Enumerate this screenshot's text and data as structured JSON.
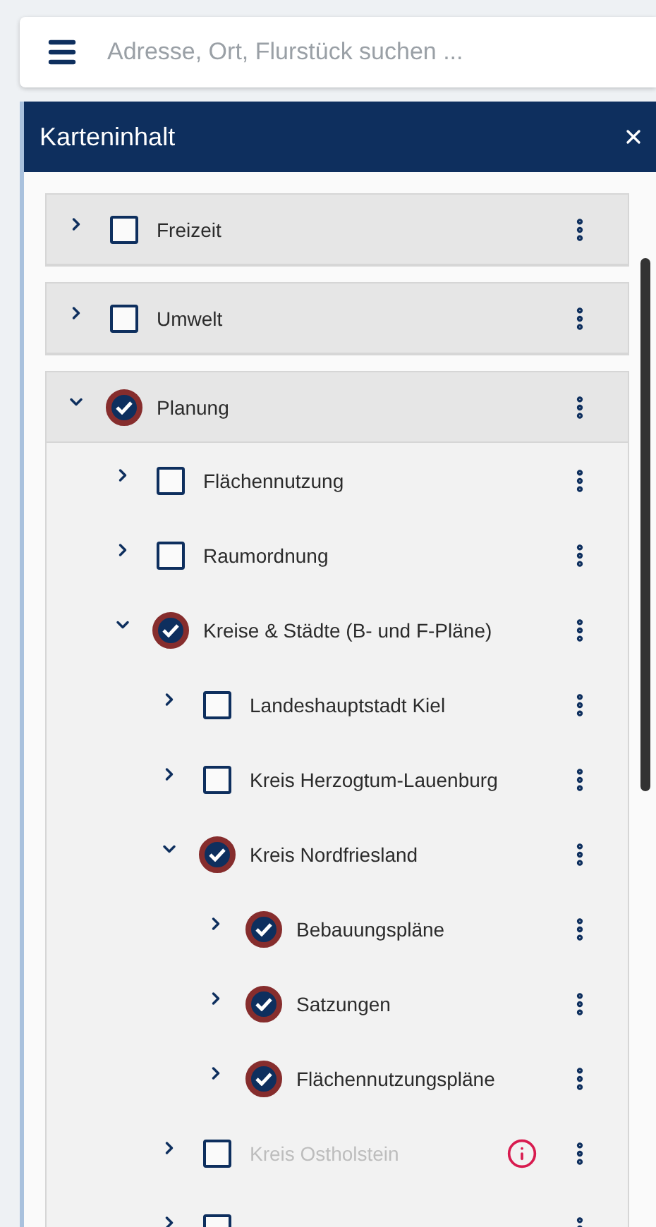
{
  "search": {
    "placeholder": "Adresse, Ort, Flurstück suchen ..."
  },
  "panel": {
    "title": "Karteninhalt"
  },
  "layers": [
    {
      "label": "Freizeit",
      "expanded": false,
      "checked": false,
      "disabled": false,
      "info": false
    },
    {
      "label": "Umwelt",
      "expanded": false,
      "checked": false,
      "disabled": false,
      "info": false
    },
    {
      "label": "Planung",
      "expanded": true,
      "checked": true,
      "disabled": false,
      "info": false,
      "children": [
        {
          "label": "Flächennutzung",
          "expanded": false,
          "checked": false,
          "disabled": false,
          "info": false
        },
        {
          "label": "Raumordnung",
          "expanded": false,
          "checked": false,
          "disabled": false,
          "info": false
        },
        {
          "label": "Kreise & Städte (B- und F-Pläne)",
          "expanded": true,
          "checked": true,
          "disabled": false,
          "info": false,
          "children": [
            {
              "label": "Landeshauptstadt Kiel",
              "expanded": false,
              "checked": false,
              "disabled": false,
              "info": false
            },
            {
              "label": "Kreis Herzogtum-Lauenburg",
              "expanded": false,
              "checked": false,
              "disabled": false,
              "info": false
            },
            {
              "label": "Kreis Nordfriesland",
              "expanded": true,
              "checked": true,
              "disabled": false,
              "info": false,
              "children": [
                {
                  "label": "Bebauungspläne",
                  "expanded": false,
                  "checked": true,
                  "disabled": false,
                  "info": false
                },
                {
                  "label": "Satzungen",
                  "expanded": false,
                  "checked": true,
                  "disabled": false,
                  "info": false
                },
                {
                  "label": "Flächennutzungspläne",
                  "expanded": false,
                  "checked": true,
                  "disabled": false,
                  "info": false
                }
              ]
            },
            {
              "label": "Kreis Ostholstein",
              "expanded": false,
              "checked": false,
              "disabled": true,
              "info": true
            },
            {
              "expanded": false,
              "checked": false
            }
          ]
        }
      ]
    }
  ]
}
